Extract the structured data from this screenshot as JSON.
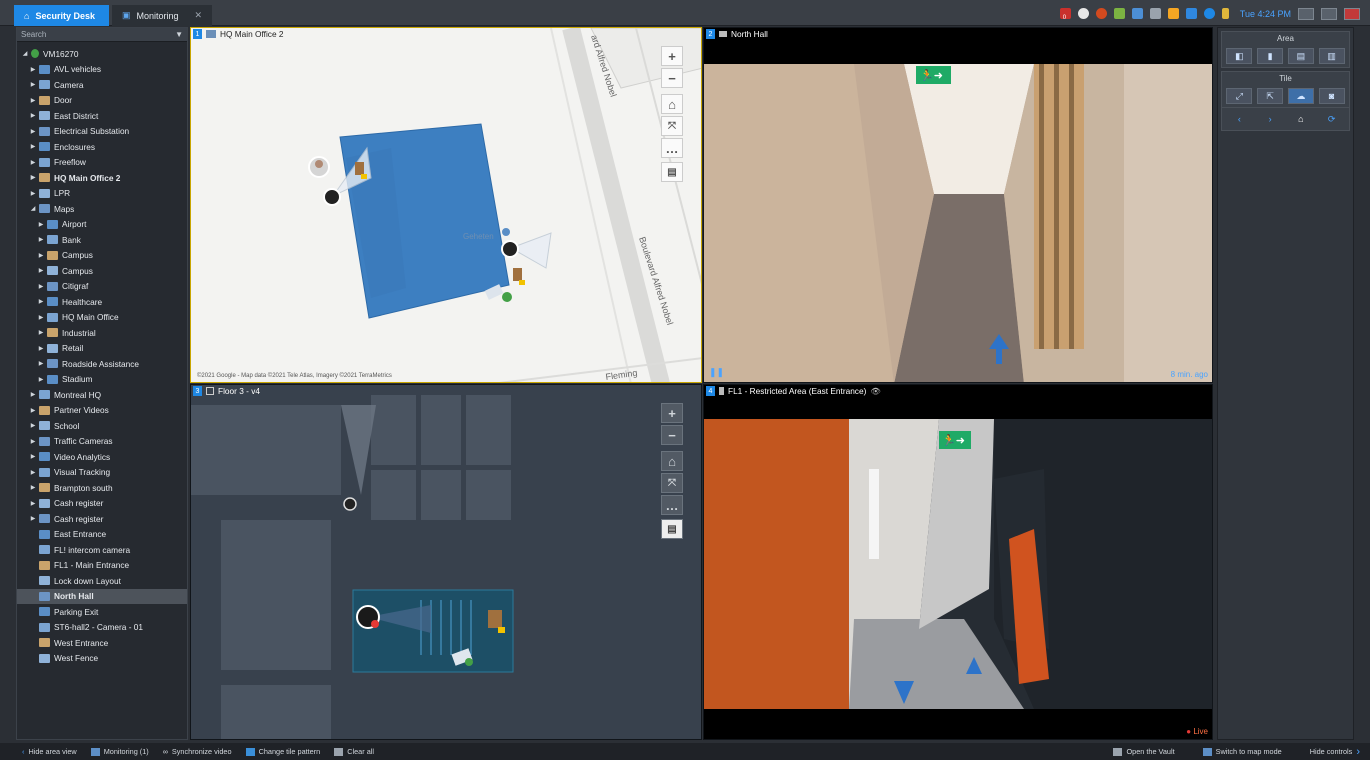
{
  "tabs": [
    {
      "label": "Security Desk"
    },
    {
      "label": "Monitoring",
      "close": "✕"
    }
  ],
  "tray": {
    "time": "Tue 4:24 PM",
    "badge": "0"
  },
  "sidebar": {
    "search_placeholder": "Search",
    "root": "VM16270",
    "items": [
      {
        "label": "AVL vehicles",
        "level": 1,
        "arrow": true,
        "bold": false
      },
      {
        "label": "Camera",
        "level": 1,
        "arrow": true,
        "bold": false
      },
      {
        "label": "Door",
        "level": 1,
        "arrow": true,
        "bold": false
      },
      {
        "label": "East District",
        "level": 1,
        "arrow": true,
        "bold": false
      },
      {
        "label": "Electrical Substation",
        "level": 1,
        "arrow": true,
        "bold": false
      },
      {
        "label": "Enclosures",
        "level": 1,
        "arrow": true,
        "bold": false
      },
      {
        "label": "Freeflow",
        "level": 1,
        "arrow": true,
        "bold": false
      },
      {
        "label": "HQ Main Office 2",
        "level": 1,
        "arrow": true,
        "bold": true
      },
      {
        "label": "LPR",
        "level": 1,
        "arrow": true,
        "bold": false
      },
      {
        "label": "Maps",
        "level": 1,
        "arrow": true,
        "expanded": true,
        "bold": false
      },
      {
        "label": "Airport",
        "level": 2,
        "arrow": true,
        "bold": false
      },
      {
        "label": "Bank",
        "level": 2,
        "arrow": true,
        "bold": false
      },
      {
        "label": "Campus",
        "level": 2,
        "arrow": true,
        "bold": false
      },
      {
        "label": "Campus",
        "level": 2,
        "arrow": true,
        "bold": false
      },
      {
        "label": "Citigraf",
        "level": 2,
        "arrow": true,
        "bold": false
      },
      {
        "label": "Healthcare",
        "level": 2,
        "arrow": true,
        "bold": false
      },
      {
        "label": "HQ Main Office",
        "level": 2,
        "arrow": true,
        "bold": false
      },
      {
        "label": "Industrial",
        "level": 2,
        "arrow": true,
        "bold": false
      },
      {
        "label": "Retail",
        "level": 2,
        "arrow": true,
        "bold": false
      },
      {
        "label": "Roadside Assistance",
        "level": 2,
        "arrow": true,
        "bold": false
      },
      {
        "label": "Stadium",
        "level": 2,
        "arrow": true,
        "bold": false
      },
      {
        "label": "Montreal HQ",
        "level": 1,
        "arrow": true,
        "bold": false
      },
      {
        "label": "Partner Videos",
        "level": 1,
        "arrow": true,
        "bold": false
      },
      {
        "label": "School",
        "level": 1,
        "arrow": true,
        "bold": false
      },
      {
        "label": "Traffic Cameras",
        "level": 1,
        "arrow": true,
        "bold": false
      },
      {
        "label": "Video Analytics",
        "level": 1,
        "arrow": true,
        "bold": false
      },
      {
        "label": "Visual Tracking",
        "level": 1,
        "arrow": true,
        "bold": false
      },
      {
        "label": "Brampton south",
        "level": 1,
        "arrow": true,
        "bold": false
      },
      {
        "label": "Cash register",
        "level": 1,
        "arrow": true,
        "bold": false
      },
      {
        "label": "Cash register",
        "level": 1,
        "arrow": true,
        "bold": false
      },
      {
        "label": "East Entrance",
        "level": 1,
        "arrow": false,
        "bold": false
      },
      {
        "label": "FL! intercom camera",
        "level": 1,
        "arrow": false,
        "bold": false
      },
      {
        "label": "FL1 - Main Entrance",
        "level": 1,
        "arrow": false,
        "bold": false
      },
      {
        "label": "Lock down Layout",
        "level": 1,
        "arrow": false,
        "bold": false
      },
      {
        "label": "North Hall",
        "level": 1,
        "arrow": false,
        "bold": true,
        "selected": true
      },
      {
        "label": "Parking Exit",
        "level": 1,
        "arrow": false,
        "bold": false
      },
      {
        "label": "ST6-hall2 - Camera - 01",
        "level": 1,
        "arrow": false,
        "bold": false
      },
      {
        "label": "West Entrance",
        "level": 1,
        "arrow": false,
        "bold": false
      },
      {
        "label": "West Fence",
        "level": 1,
        "arrow": false,
        "bold": false
      }
    ]
  },
  "tiles": {
    "t1": {
      "num": "1",
      "title": "HQ Main Office 2",
      "copyright": "©2021 Google - Map data ©2021 Tele Atlas, Imagery ©2021 TerraMetrics",
      "street1": "Boulevard Alfred Nobel",
      "street2": "ard Alfred Nobel",
      "street3": "Fleming",
      "poi": "Geheten"
    },
    "t2": {
      "num": "2",
      "title": "North Hall",
      "status": "8 min. ago"
    },
    "t3": {
      "num": "3",
      "title": "Floor 3 - v4"
    },
    "t4": {
      "num": "4",
      "title": "FL1 - Restricted Area  (East Entrance)",
      "status": "Live"
    }
  },
  "map_tools": {
    "zoom_in": "+",
    "zoom_out": "−",
    "more": "…"
  },
  "right_panel": {
    "area_title": "Area",
    "tile_title": "Tile"
  },
  "statusbar": {
    "left": [
      "Hide area view",
      "Monitoring (1)",
      "Synchronize video",
      "Change tile pattern",
      "Clear all"
    ],
    "right": [
      "Open the Vault",
      "Switch to map mode",
      "Hide controls"
    ]
  },
  "colors": {
    "accent": "#1e88e5",
    "live": "#e53935"
  }
}
